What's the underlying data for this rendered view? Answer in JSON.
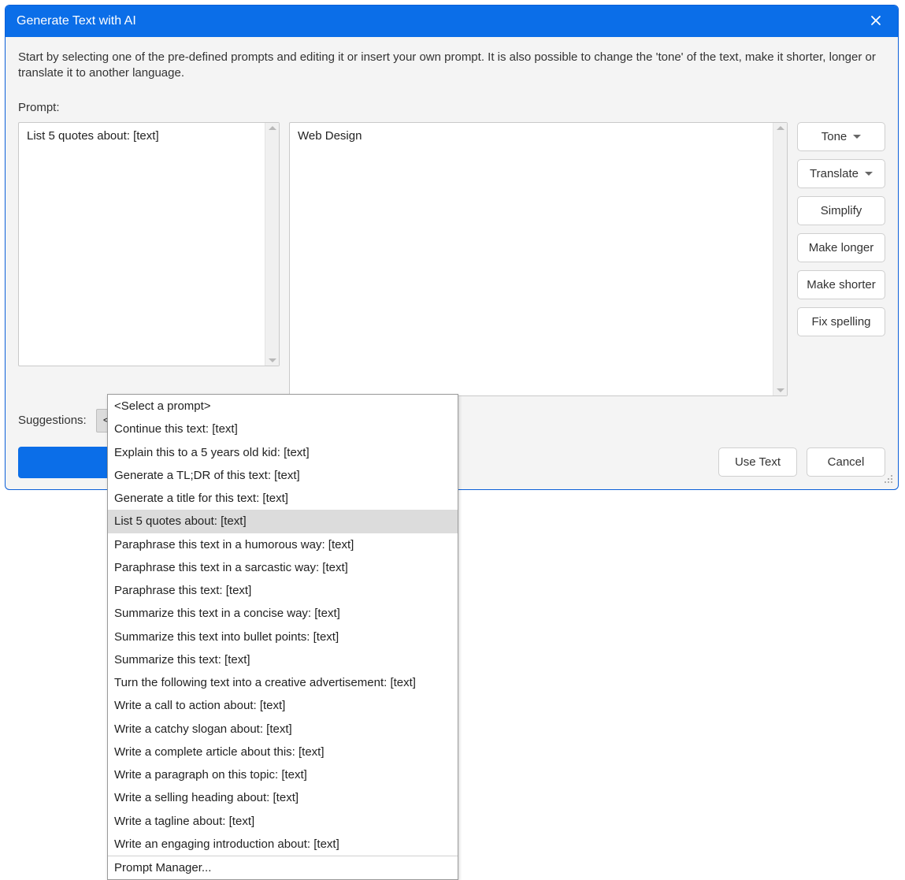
{
  "titlebar": {
    "title": "Generate Text with AI"
  },
  "intro": "Start by selecting one of the pre-defined prompts and editing it or insert your own prompt. It is also possible to change the 'tone' of the text, make it shorter, longer or translate it to another language.",
  "prompt": {
    "label": "Prompt:",
    "value": "List 5 quotes about: [text]"
  },
  "output": {
    "value": "Web Design"
  },
  "toolbar": {
    "tone": "Tone",
    "translate": "Translate",
    "simplify": "Simplify",
    "make_longer": "Make longer",
    "make_shorter": "Make shorter",
    "fix_spelling": "Fix spelling"
  },
  "suggestions": {
    "label": "Suggestions:",
    "selected": "<Select a prompt>",
    "options": [
      "<Select a prompt>",
      "Continue this text: [text]",
      "Explain this to a 5 years old kid: [text]",
      "Generate a TL;DR of this text: [text]",
      "Generate a title for this text: [text]",
      "List 5 quotes about: [text]",
      "Paraphrase this text in a humorous way: [text]",
      "Paraphrase this text in a sarcastic way: [text]",
      "Paraphrase this text: [text]",
      "Summarize this text in a concise way: [text]",
      "Summarize this text into bullet points: [text]",
      "Summarize this text: [text]",
      "Turn the following text into a creative advertisement: [text]",
      "Write a call to action about: [text]",
      "Write a catchy slogan about: [text]",
      "Write a complete article about this: [text]",
      "Write a paragraph on this topic: [text]",
      "Write a selling heading about: [text]",
      "Write a tagline about: [text]",
      "Write an engaging introduction about: [text]"
    ],
    "highlighted_index": 5,
    "manager": "Prompt Manager..."
  },
  "footer": {
    "use_text": "Use Text",
    "cancel": "Cancel"
  }
}
